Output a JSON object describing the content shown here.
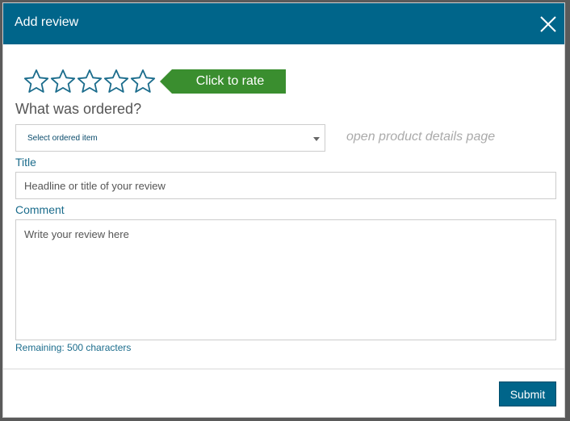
{
  "dialog": {
    "title": "Add review",
    "close_icon": "close-icon"
  },
  "rating": {
    "star_count": 5,
    "selected": 0,
    "star_icon": "star-outline-icon",
    "prompt_label": "Click to rate",
    "prompt_color": "#3a8e2f",
    "star_color": "#1b6c8c"
  },
  "order": {
    "question": "What was ordered?",
    "select_value": "Select ordered item",
    "product_link": "open product details page"
  },
  "title_field": {
    "label": "Title",
    "placeholder": "Headline or title of your review",
    "value": ""
  },
  "comment_field": {
    "label": "Comment",
    "placeholder": "Write your review here",
    "value": "",
    "remaining_text": "Remaining: 500 characters"
  },
  "footer": {
    "submit_label": "Submit"
  },
  "colors": {
    "header": "#00658a",
    "accent_text": "#1b6c8c",
    "button": "#00658a"
  }
}
